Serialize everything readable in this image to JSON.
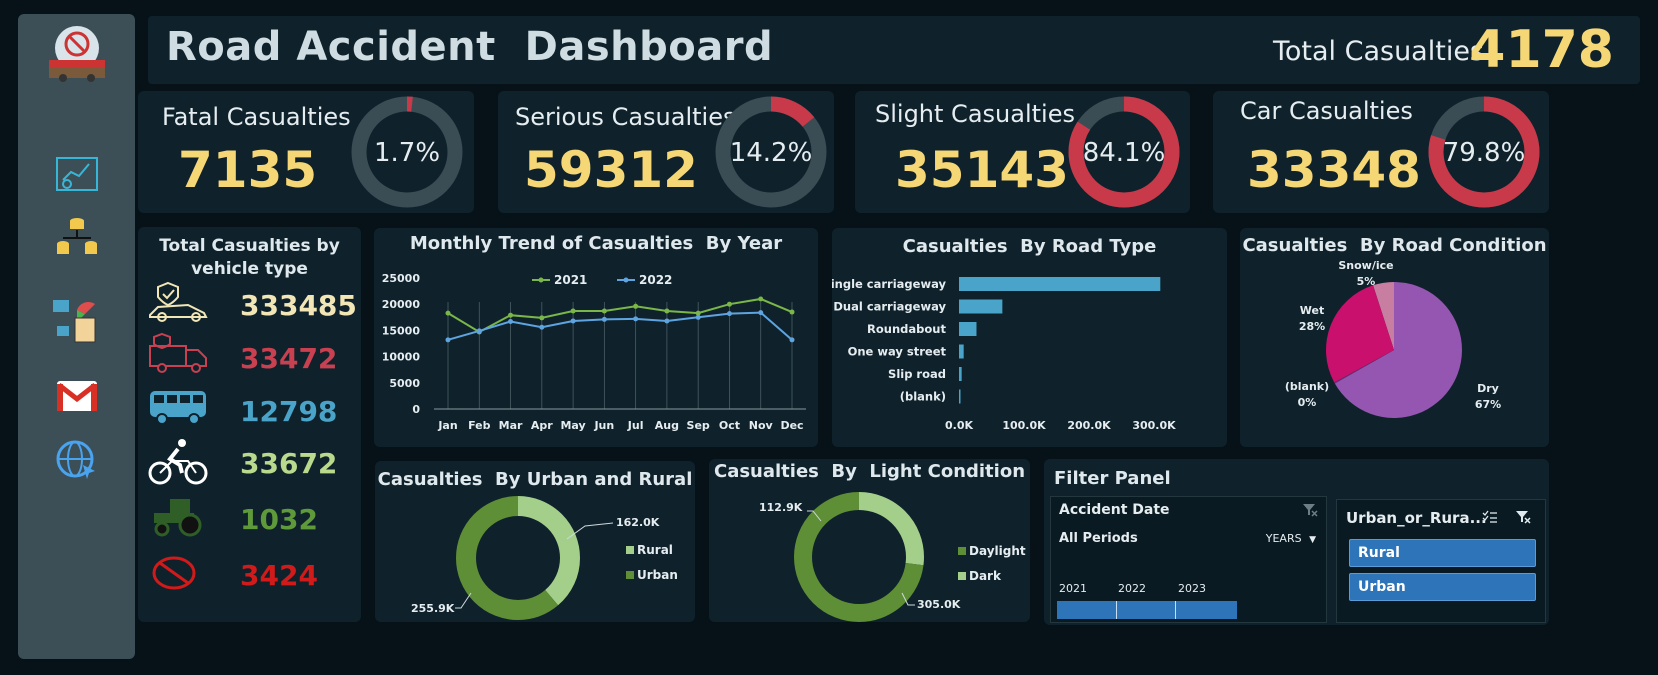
{
  "header": {
    "title": "Road Accident  Dashboard",
    "total_label": "Total Casualties",
    "total_value": "4178"
  },
  "sidebar": {
    "icons": [
      "accident-logo-icon",
      "dashboard-icon",
      "database-icon",
      "report-icon",
      "gmail-icon",
      "web-icon"
    ]
  },
  "kpis": [
    {
      "label": "Fatal Casualties",
      "value": "7135",
      "pct_text": "1.7%",
      "pct": 1.7
    },
    {
      "label": "Serious Casualties",
      "value": "59312",
      "pct_text": "14.2%",
      "pct": 14.2
    },
    {
      "label": "Slight Casualties",
      "value": "35143",
      "pct_text": "84.1%",
      "pct": 84.1
    },
    {
      "label": "Car Casualties",
      "value": "33348",
      "pct_text": "79.8%",
      "pct": 79.8
    }
  ],
  "vehicle": {
    "title_line1": "Total Casualties by",
    "title_line2": "vehicle type",
    "items": [
      {
        "icon": "car-icon",
        "value": "333485",
        "color": "#f3e6b6"
      },
      {
        "icon": "van-icon",
        "value": "33472",
        "color": "#c94050"
      },
      {
        "icon": "bus-icon",
        "value": "12798",
        "color": "#4aa3c8"
      },
      {
        "icon": "bicycle-icon",
        "value": "33672",
        "color": "#b9d98c"
      },
      {
        "icon": "tractor-icon",
        "value": "1032",
        "color": "#5e9a3a"
      },
      {
        "icon": "other-icon",
        "value": "3424",
        "color": "#d11a1a"
      }
    ]
  },
  "chart_data": [
    {
      "type": "line",
      "title": "Monthly Trend of Casualties  By Year",
      "categories": [
        "Jan",
        "Feb",
        "Mar",
        "Apr",
        "May",
        "Jun",
        "Jul",
        "Aug",
        "Sep",
        "Oct",
        "Nov",
        "Dec"
      ],
      "yticks": [
        "25000",
        "20000",
        "15000",
        "10000",
        "5000",
        "0"
      ],
      "ylim": [
        0,
        25000
      ],
      "series": [
        {
          "name": "2021",
          "color": "#7ab648",
          "values": [
            18300,
            14700,
            17900,
            17400,
            18700,
            18700,
            19600,
            18700,
            18300,
            20000,
            21000,
            18500
          ]
        },
        {
          "name": "2022",
          "color": "#5ea4e0",
          "values": [
            13200,
            14900,
            16700,
            15600,
            16800,
            17100,
            17200,
            16800,
            17500,
            18200,
            18400,
            13200
          ]
        }
      ]
    },
    {
      "type": "bar",
      "title": "Casualties  By Road Type",
      "categories": [
        "Single carriageway",
        "Dual carriageway",
        "Roundabout",
        "One way street",
        "Slip road",
        "(blank)"
      ],
      "values": [
        309700,
        66700,
        26900,
        7200,
        4100,
        800
      ],
      "xticks": [
        "0.0K",
        "100.0K",
        "200.0K",
        "300.0K"
      ],
      "xlim": [
        0,
        300000
      ],
      "color": "#4aa3c8"
    },
    {
      "type": "pie",
      "title": "Casualties  By Road Condition",
      "slices": [
        {
          "name": "Dry",
          "pct_label": "67%",
          "value": 67,
          "color": "#9456b0"
        },
        {
          "name": "(blank)",
          "pct_label": "0%",
          "value": 0.3,
          "color": "#6b2d7e"
        },
        {
          "name": "Wet",
          "pct_label": "28%",
          "value": 28,
          "color": "#c8106c"
        },
        {
          "name": "Snow/ice",
          "pct_label": "5%",
          "value": 5,
          "color": "#c77ea0"
        }
      ]
    },
    {
      "type": "pie",
      "title": "Casualties  By Urban and Rural",
      "slices": [
        {
          "name": "Rural",
          "label": "162.0K",
          "value": 162.0,
          "color": "#a3cf8a"
        },
        {
          "name": "Urban",
          "label": "255.9K",
          "value": 255.9,
          "color": "#5e8f36"
        }
      ]
    },
    {
      "type": "pie",
      "title": "Casualties  By  Light Condition",
      "slices": [
        {
          "name": "Daylight",
          "label": "305.0K",
          "value": 305.0,
          "color": "#5e8f36"
        },
        {
          "name": "Dark",
          "label": "112.9K",
          "value": 112.9,
          "color": "#a3cf8a"
        }
      ]
    }
  ],
  "filter": {
    "title": "Filter Panel",
    "timeline": {
      "title": "Accident Date",
      "period": "All Periods",
      "unit": "YEARS",
      "years": [
        "2021",
        "2022",
        "2023"
      ]
    },
    "slicer": {
      "title": "Urban_or_Rura...",
      "items": [
        "Rural",
        "Urban"
      ]
    }
  }
}
